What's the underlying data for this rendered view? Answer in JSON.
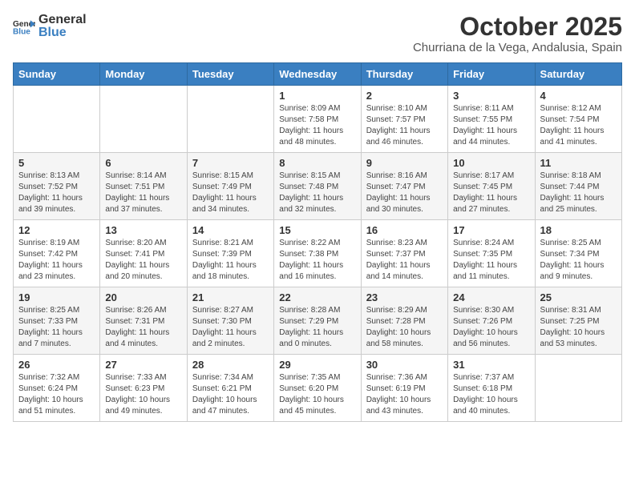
{
  "logo": {
    "text_general": "General",
    "text_blue": "Blue"
  },
  "title": "October 2025",
  "subtitle": "Churriana de la Vega, Andalusia, Spain",
  "days_of_week": [
    "Sunday",
    "Monday",
    "Tuesday",
    "Wednesday",
    "Thursday",
    "Friday",
    "Saturday"
  ],
  "weeks": [
    [
      {
        "day": "",
        "info": ""
      },
      {
        "day": "",
        "info": ""
      },
      {
        "day": "",
        "info": ""
      },
      {
        "day": "1",
        "info": "Sunrise: 8:09 AM\nSunset: 7:58 PM\nDaylight: 11 hours and 48 minutes."
      },
      {
        "day": "2",
        "info": "Sunrise: 8:10 AM\nSunset: 7:57 PM\nDaylight: 11 hours and 46 minutes."
      },
      {
        "day": "3",
        "info": "Sunrise: 8:11 AM\nSunset: 7:55 PM\nDaylight: 11 hours and 44 minutes."
      },
      {
        "day": "4",
        "info": "Sunrise: 8:12 AM\nSunset: 7:54 PM\nDaylight: 11 hours and 41 minutes."
      }
    ],
    [
      {
        "day": "5",
        "info": "Sunrise: 8:13 AM\nSunset: 7:52 PM\nDaylight: 11 hours and 39 minutes."
      },
      {
        "day": "6",
        "info": "Sunrise: 8:14 AM\nSunset: 7:51 PM\nDaylight: 11 hours and 37 minutes."
      },
      {
        "day": "7",
        "info": "Sunrise: 8:15 AM\nSunset: 7:49 PM\nDaylight: 11 hours and 34 minutes."
      },
      {
        "day": "8",
        "info": "Sunrise: 8:15 AM\nSunset: 7:48 PM\nDaylight: 11 hours and 32 minutes."
      },
      {
        "day": "9",
        "info": "Sunrise: 8:16 AM\nSunset: 7:47 PM\nDaylight: 11 hours and 30 minutes."
      },
      {
        "day": "10",
        "info": "Sunrise: 8:17 AM\nSunset: 7:45 PM\nDaylight: 11 hours and 27 minutes."
      },
      {
        "day": "11",
        "info": "Sunrise: 8:18 AM\nSunset: 7:44 PM\nDaylight: 11 hours and 25 minutes."
      }
    ],
    [
      {
        "day": "12",
        "info": "Sunrise: 8:19 AM\nSunset: 7:42 PM\nDaylight: 11 hours and 23 minutes."
      },
      {
        "day": "13",
        "info": "Sunrise: 8:20 AM\nSunset: 7:41 PM\nDaylight: 11 hours and 20 minutes."
      },
      {
        "day": "14",
        "info": "Sunrise: 8:21 AM\nSunset: 7:39 PM\nDaylight: 11 hours and 18 minutes."
      },
      {
        "day": "15",
        "info": "Sunrise: 8:22 AM\nSunset: 7:38 PM\nDaylight: 11 hours and 16 minutes."
      },
      {
        "day": "16",
        "info": "Sunrise: 8:23 AM\nSunset: 7:37 PM\nDaylight: 11 hours and 14 minutes."
      },
      {
        "day": "17",
        "info": "Sunrise: 8:24 AM\nSunset: 7:35 PM\nDaylight: 11 hours and 11 minutes."
      },
      {
        "day": "18",
        "info": "Sunrise: 8:25 AM\nSunset: 7:34 PM\nDaylight: 11 hours and 9 minutes."
      }
    ],
    [
      {
        "day": "19",
        "info": "Sunrise: 8:25 AM\nSunset: 7:33 PM\nDaylight: 11 hours and 7 minutes."
      },
      {
        "day": "20",
        "info": "Sunrise: 8:26 AM\nSunset: 7:31 PM\nDaylight: 11 hours and 4 minutes."
      },
      {
        "day": "21",
        "info": "Sunrise: 8:27 AM\nSunset: 7:30 PM\nDaylight: 11 hours and 2 minutes."
      },
      {
        "day": "22",
        "info": "Sunrise: 8:28 AM\nSunset: 7:29 PM\nDaylight: 11 hours and 0 minutes."
      },
      {
        "day": "23",
        "info": "Sunrise: 8:29 AM\nSunset: 7:28 PM\nDaylight: 10 hours and 58 minutes."
      },
      {
        "day": "24",
        "info": "Sunrise: 8:30 AM\nSunset: 7:26 PM\nDaylight: 10 hours and 56 minutes."
      },
      {
        "day": "25",
        "info": "Sunrise: 8:31 AM\nSunset: 7:25 PM\nDaylight: 10 hours and 53 minutes."
      }
    ],
    [
      {
        "day": "26",
        "info": "Sunrise: 7:32 AM\nSunset: 6:24 PM\nDaylight: 10 hours and 51 minutes."
      },
      {
        "day": "27",
        "info": "Sunrise: 7:33 AM\nSunset: 6:23 PM\nDaylight: 10 hours and 49 minutes."
      },
      {
        "day": "28",
        "info": "Sunrise: 7:34 AM\nSunset: 6:21 PM\nDaylight: 10 hours and 47 minutes."
      },
      {
        "day": "29",
        "info": "Sunrise: 7:35 AM\nSunset: 6:20 PM\nDaylight: 10 hours and 45 minutes."
      },
      {
        "day": "30",
        "info": "Sunrise: 7:36 AM\nSunset: 6:19 PM\nDaylight: 10 hours and 43 minutes."
      },
      {
        "day": "31",
        "info": "Sunrise: 7:37 AM\nSunset: 6:18 PM\nDaylight: 10 hours and 40 minutes."
      },
      {
        "day": "",
        "info": ""
      }
    ]
  ]
}
